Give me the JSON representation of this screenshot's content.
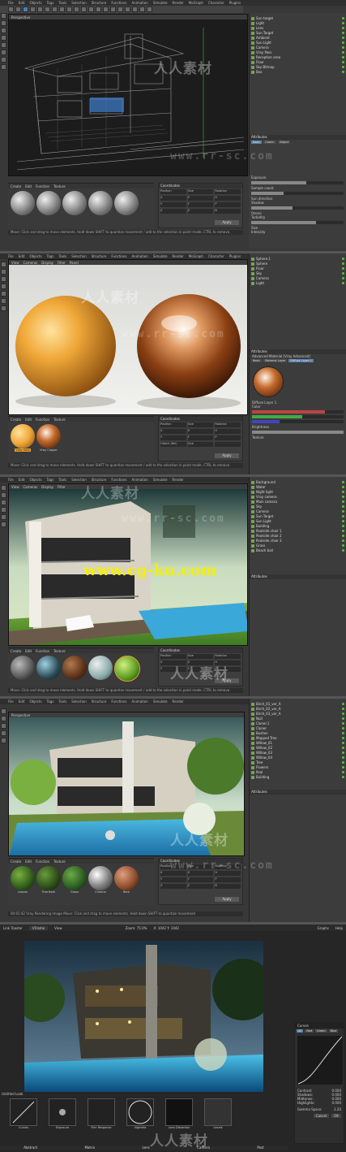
{
  "menu": [
    "File",
    "Edit",
    "Objects",
    "Tags",
    "Tools",
    "Selection",
    "Structure",
    "Functions",
    "Animation",
    "Simulate",
    "Render",
    "MoGraph",
    "Character",
    "Plugins",
    "Script",
    "Window",
    "Help"
  ],
  "viewport_menu": [
    "View",
    "Cameras",
    "Display",
    "Filter",
    "Panel"
  ],
  "viewport_menu_short": [
    "View",
    "Cameras",
    "Display",
    "Filter"
  ],
  "right_menu": [
    "File",
    "Edit",
    "View",
    "Objects",
    "Tags",
    "Bookmarks"
  ],
  "material_menu": [
    "Create",
    "Edit",
    "Function",
    "Texture"
  ],
  "coordinates": {
    "title": "Coordinates",
    "position": "Position",
    "size": "Size",
    "rotation": "Rotation",
    "x": "X",
    "y": "Y",
    "z": "Z",
    "h": "H",
    "p": "P",
    "b": "B",
    "object_rel": "Object (Rel)",
    "size_label": "Size",
    "apply": "Apply"
  },
  "watermark_cn": "人人素材",
  "watermark_url": "www.rr-sc.com",
  "watermark_site": "www.cg-ku.com",
  "panel1": {
    "viewport_title": "Perspective",
    "objects": [
      "Sun target",
      "Light",
      "Lens",
      "Sun Target",
      "Ambient",
      "Sun Light",
      "Camera",
      "Vray Pass",
      "Reception area",
      "Floor",
      "Sky Bitmap",
      "Box"
    ],
    "materials_title": "Materials",
    "attr_title": "Attributes",
    "attr_tabs": [
      "Basic",
      "Coord.",
      "Object"
    ],
    "attr_fields": [
      "Exposure",
      "Sample count",
      "Sun direction",
      "Shadow",
      "Ozone",
      "Turbidity",
      "Size",
      "Intensity",
      "Invisible",
      "Sun Power"
    ],
    "status": "Move: Click and drag to move elements. Hold down SHIFT to quantize movement / add to the selection in point mode, CTRL to remove."
  },
  "panel2": {
    "objects": [
      "Sphere.1",
      "Sphere",
      "Floor",
      "Sky",
      "Camera",
      "Light"
    ],
    "attr_title": "Attributes",
    "attr_tabs": [
      "Basic",
      "Material Layer",
      "Diffuse Layer 1"
    ],
    "material_title": "Advanced Material [Vray Advanced]",
    "layer_label": "Diffuse Layer 1",
    "color_label": "Color",
    "brightness_label": "Brightness",
    "texture_label": "Texture",
    "mat_labels": [
      "Vray Gold",
      "Vray Copper"
    ],
    "status": "Move: Click and drag to move elements. Hold down SHIFT to quantize movement / add to the selection in point mode, CTRL to remove."
  },
  "panel3": {
    "objects": [
      "Background",
      "Water",
      "Night light",
      "Vray camera",
      "Main camera",
      "Sky",
      "Camera",
      "Sun Target",
      "Sun Light",
      "Building",
      "Poolside chair 1",
      "Poolside chair 2",
      "Poolside chair 3",
      "Grass",
      "Beach ball"
    ],
    "attr_title": "Attributes",
    "status": "Move: Click and drag to move elements. Hold down SHIFT to quantize movement / add to the selection in point mode, CTRL to remove.",
    "mat_labels": [
      "Chrome",
      "Glass",
      "Wood",
      "Tiles",
      "Grass"
    ]
  },
  "panel4": {
    "viewport_title": "Perspective",
    "objects": [
      "Birch_01_ver_A",
      "Birch_02_ver_A",
      "Birch_03_ver_A",
      "Null",
      "Cloner.1",
      "Cloner",
      "Bushes",
      "Mapped Tree",
      "Willow_01",
      "Willow_02",
      "Willow_03",
      "Willow_04",
      "Tree",
      "Flowers",
      "Pool",
      "Building"
    ],
    "attr_title": "Attributes",
    "mat_labels": [
      "Leaves",
      "Tree Bark",
      "Grass",
      "Chrome",
      "Bark"
    ],
    "status": "00:01:42 Vray Rendering Image   Move: Click and drag to move elements. Hold down SHIFT to quantize movement"
  },
  "panel5": {
    "title": "Link Toaster",
    "mode": "VFrame",
    "view_label": "View",
    "zoom": "Zoom: 75.0%",
    "coords": "X: 1042   Y: 1042",
    "graphs_label": "Graphs",
    "help_label": "Help",
    "curves_title": "Curves",
    "curve_tabs": [
      "All",
      "Red",
      "Green",
      "Blue"
    ],
    "params": [
      {
        "k": "Contrast:",
        "v": "0.000"
      },
      {
        "k": "Shadows:",
        "v": "0.000"
      },
      {
        "k": "Midtones:",
        "v": "0.000"
      },
      {
        "k": "Highlights:",
        "v": "0.000"
      }
    ],
    "gamma_label": "Gamma Space:",
    "gamma_value": "2.20",
    "cancel": "Cancel",
    "ok": "OK",
    "layer_title": "Untitled Look",
    "thumb_labels": [
      "Curves",
      "Exposure",
      "Film Response",
      "Vignette",
      "Lens Distortion",
      "Levels"
    ],
    "bottom_tabs": [
      "Abstract",
      "Matrix",
      "Lens",
      "Camera",
      "Post"
    ]
  },
  "colors": {
    "ui_bg": "#383838",
    "accent": "#4a7fb8",
    "gold": "#e8a23c",
    "copper": "#c46a2c"
  }
}
